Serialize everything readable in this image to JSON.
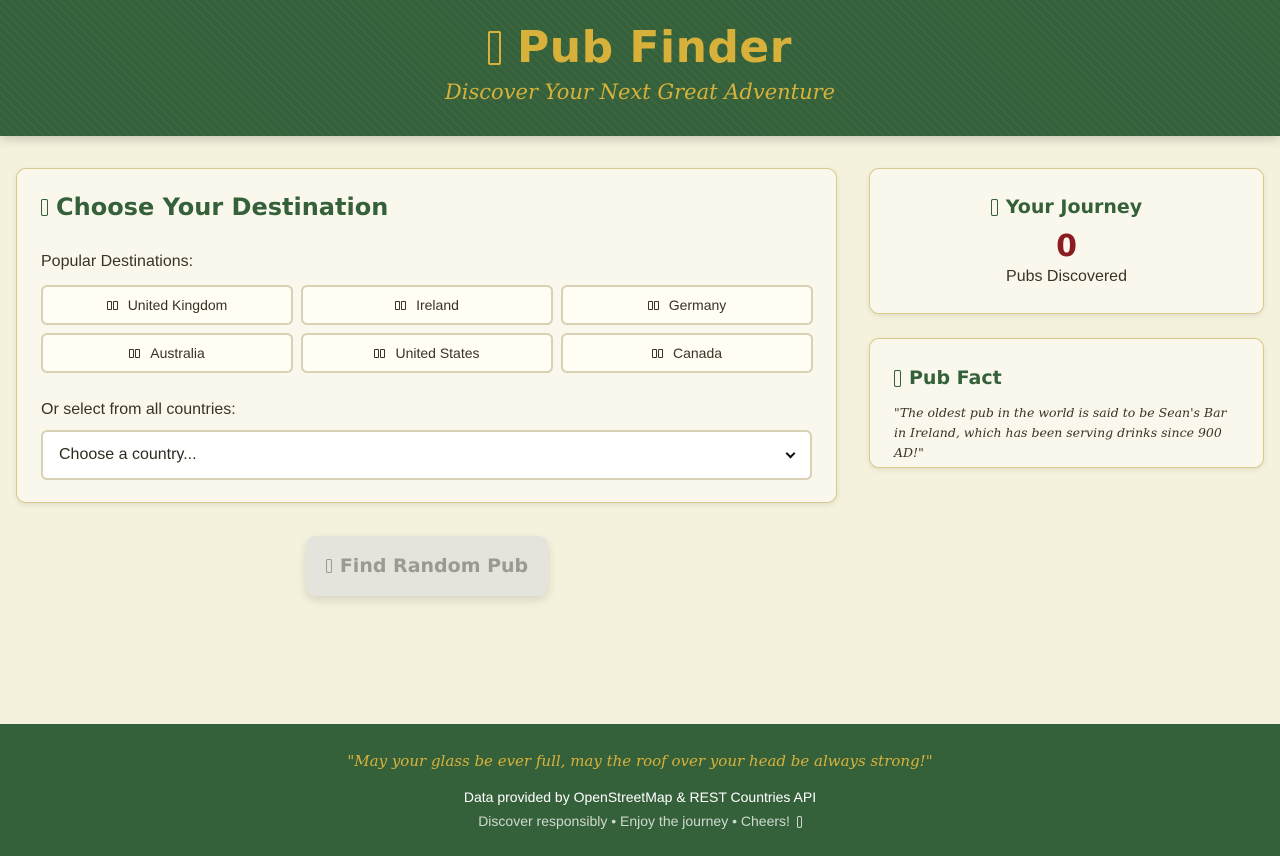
{
  "header": {
    "title": "Pub Finder",
    "subtitle": "Discover Your Next Great Adventure",
    "icon": "beer-mug-icon"
  },
  "destination": {
    "title": "Choose Your Destination",
    "icon": "globe-icon",
    "popular_label": "Popular Destinations:",
    "countries": [
      {
        "label": "United Kingdom",
        "icon": "flag-gb-icon"
      },
      {
        "label": "Ireland",
        "icon": "flag-ie-icon"
      },
      {
        "label": "Germany",
        "icon": "flag-de-icon"
      },
      {
        "label": "Australia",
        "icon": "flag-au-icon"
      },
      {
        "label": "United States",
        "icon": "flag-us-icon"
      },
      {
        "label": "Canada",
        "icon": "flag-ca-icon"
      }
    ],
    "all_label": "Or select from all countries:",
    "select_value": "Choose a country..."
  },
  "find_button": {
    "label": "Find Random Pub",
    "icon": "dice-icon",
    "disabled": true
  },
  "journey": {
    "title": "Your Journey",
    "icon": "map-icon",
    "count": "0",
    "caption": "Pubs Discovered"
  },
  "fact": {
    "title": "Pub Fact",
    "icon": "lightbulb-icon",
    "text": "\"The oldest pub in the world is said to be Sean's Bar in Ireland, which has been serving drinks since 900 AD!\""
  },
  "footer": {
    "quote": "\"May your glass be ever full, may the roof over your head be always strong!\"",
    "credit": "Data provided by OpenStreetMap & REST Countries API",
    "tagline": "Discover responsibly • Enjoy the journey • Cheers!"
  },
  "colors": {
    "brand_green": "#34603a",
    "gold": "#d8b13b",
    "background": "#f4f2dc",
    "counter_red": "#8a1c22"
  }
}
